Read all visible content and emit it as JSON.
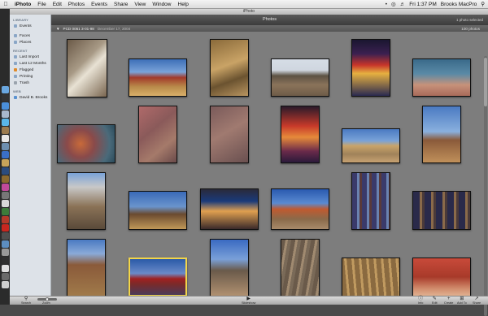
{
  "menubar": {
    "apple": "",
    "items": [
      "iPhoto",
      "File",
      "Edit",
      "Photos",
      "Events",
      "Share",
      "View",
      "Window",
      "Help"
    ],
    "clock": "Fri 1:37 PM",
    "user": "Brooks MacPro"
  },
  "window": {
    "title": "iPhoto",
    "main_title": "Photos",
    "selection_status": "1 photo selected"
  },
  "sidebar": {
    "sections": [
      {
        "header": "LIBRARY",
        "items": [
          "Events"
        ]
      },
      {
        "header": "",
        "items": [
          "Faces",
          "Places"
        ]
      },
      {
        "header": "RECENT",
        "items": [
          "Last Import",
          "Last 12 Months",
          "Flagged",
          "Printing",
          "Trash"
        ]
      },
      {
        "header": "WEB",
        "items": [
          "David B. Brooks"
        ]
      }
    ]
  },
  "event": {
    "name": "PCD 0061 3-01-98",
    "date": "December 17, 2004",
    "count": "100 photos"
  },
  "toolbar": {
    "search": "Search",
    "zoom": "Zoom",
    "slideshow": "Slideshow",
    "info": "Info",
    "edit": "Edit",
    "create": "Create",
    "add_to": "Add To",
    "share": "Share"
  }
}
